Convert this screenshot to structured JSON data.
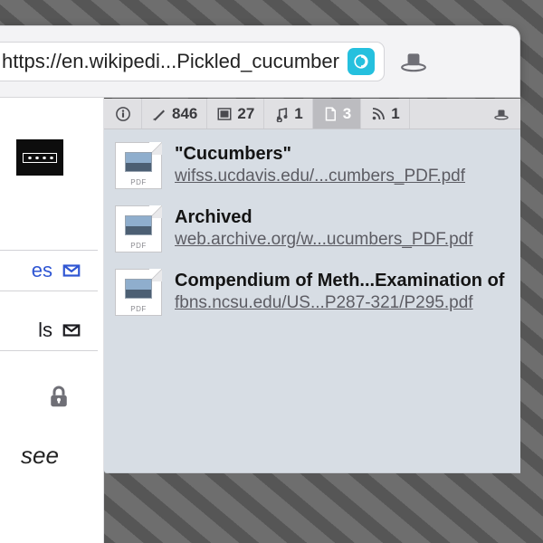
{
  "address": {
    "url_display": "https://en.wikipedi...Pickled_cucumber",
    "favicon_kind": "reader-badge",
    "favicon_color": "#25c0de"
  },
  "toolbar": {
    "info_icon": "info-italic",
    "items": [
      {
        "icon": "link-pen",
        "count": "846"
      },
      {
        "icon": "image",
        "count": "27"
      },
      {
        "icon": "music",
        "count": "1"
      },
      {
        "icon": "document",
        "count": "3",
        "active": true
      },
      {
        "icon": "rss",
        "count": "1"
      }
    ],
    "right_icon": "magic-hat"
  },
  "documents": [
    {
      "title": "\"Cucumbers\"",
      "url": "wifss.ucdavis.edu/...cumbers_PDF.pdf",
      "badge": "PDF"
    },
    {
      "title": "Archived",
      "url": "web.archive.org/w...ucumbers_PDF.pdf",
      "badge": "PDF"
    },
    {
      "title": "Compendium of Meth...Examination of",
      "url": "fbns.ncsu.edu/US...P287-321/P295.pdf",
      "badge": "PDF"
    }
  ],
  "sidebar": {
    "row1_label": "es",
    "row2_label": "ls",
    "italic_label": "see"
  },
  "colors": {
    "panel_bg": "#d7dde4",
    "toolbar_bg": "#e0e0e3",
    "active_tab_bg": "#bcbcc0",
    "link_blue": "#2f56d3"
  }
}
